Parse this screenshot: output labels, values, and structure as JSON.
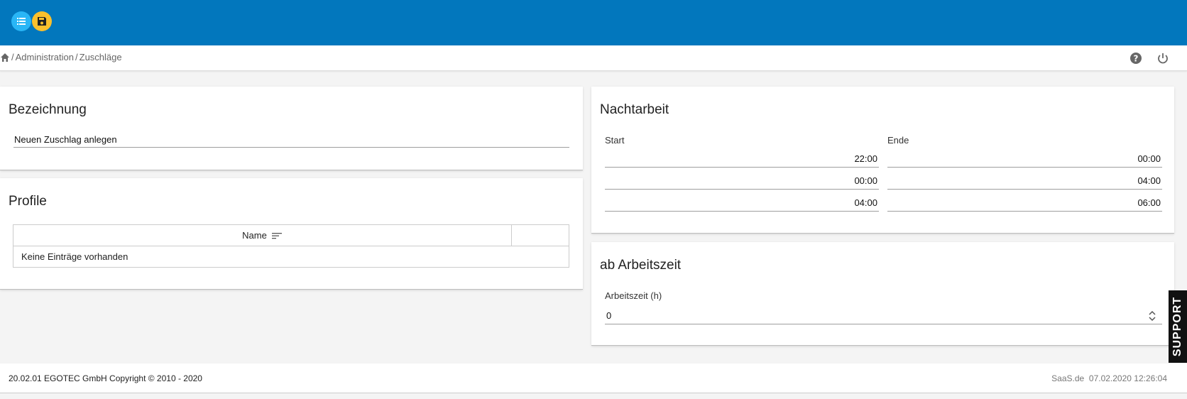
{
  "topbar": {
    "buttons": [
      {
        "icon": "list-icon",
        "color": "#29b6f6"
      },
      {
        "icon": "save-icon",
        "color": "#fbc02d"
      }
    ],
    "color": "#0277bd"
  },
  "breadcrumb": {
    "items": [
      "Administration",
      "Zuschläge"
    ],
    "separator": "/"
  },
  "bezeichnung": {
    "title": "Bezeichnung",
    "value": "Neuen Zuschlag anlegen"
  },
  "profile": {
    "title": "Profile",
    "column_name": "Name",
    "empty_text": "Keine Einträge vorhanden"
  },
  "nachtarbeit": {
    "title": "Nachtarbeit",
    "start_label": "Start",
    "end_label": "Ende",
    "rows": [
      {
        "start": "22:00",
        "end": "00:00"
      },
      {
        "start": "00:00",
        "end": "04:00"
      },
      {
        "start": "04:00",
        "end": "06:00"
      }
    ]
  },
  "ab_arbeitszeit": {
    "title": "ab Arbeitszeit",
    "label": "Arbeitszeit (h)",
    "value": "0"
  },
  "support": {
    "label": "SUPPORT"
  },
  "footer": {
    "left": "20.02.01 EGOTEC GmbH Copyright © 2010 - 2020",
    "brand": "SaaS.de",
    "datetime": "07.02.2020 12:26:04"
  }
}
